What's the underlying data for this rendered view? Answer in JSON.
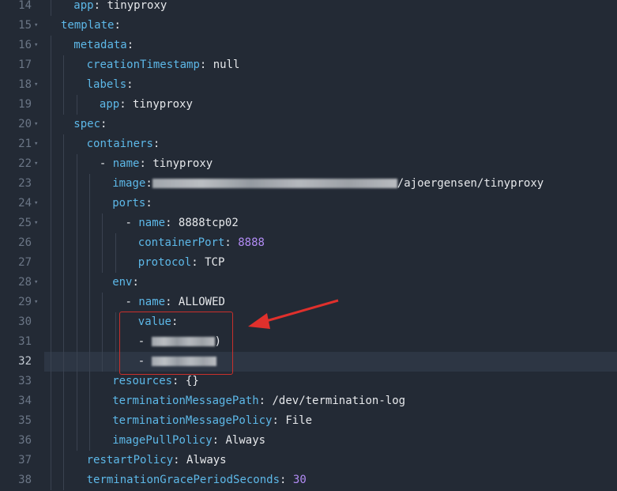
{
  "editor": {
    "lines": [
      {
        "n": "14",
        "fold": false,
        "indent": 2,
        "parts": [
          {
            "t": "app",
            "c": "key"
          },
          {
            "t": ": tinyproxy",
            "c": "txt"
          }
        ]
      },
      {
        "n": "15",
        "fold": true,
        "indent": 1,
        "parts": [
          {
            "t": "template",
            "c": "key"
          },
          {
            "t": ":",
            "c": "txt"
          }
        ]
      },
      {
        "n": "16",
        "fold": true,
        "indent": 2,
        "parts": [
          {
            "t": "metadata",
            "c": "key"
          },
          {
            "t": ":",
            "c": "txt"
          }
        ]
      },
      {
        "n": "17",
        "fold": false,
        "indent": 3,
        "parts": [
          {
            "t": "creationTimestamp",
            "c": "key"
          },
          {
            "t": ": null",
            "c": "txt"
          }
        ]
      },
      {
        "n": "18",
        "fold": true,
        "indent": 3,
        "parts": [
          {
            "t": "labels",
            "c": "key"
          },
          {
            "t": ":",
            "c": "txt"
          }
        ]
      },
      {
        "n": "19",
        "fold": false,
        "indent": 4,
        "parts": [
          {
            "t": "app",
            "c": "key"
          },
          {
            "t": ": tinyproxy",
            "c": "txt"
          }
        ]
      },
      {
        "n": "20",
        "fold": true,
        "indent": 2,
        "parts": [
          {
            "t": "spec",
            "c": "key"
          },
          {
            "t": ":",
            "c": "txt"
          }
        ]
      },
      {
        "n": "21",
        "fold": true,
        "indent": 3,
        "parts": [
          {
            "t": "containers",
            "c": "key"
          },
          {
            "t": ":",
            "c": "txt"
          }
        ]
      },
      {
        "n": "22",
        "fold": true,
        "indent": 4,
        "parts": [
          {
            "t": "- ",
            "c": "txt"
          },
          {
            "t": "name",
            "c": "key"
          },
          {
            "t": ": tinyproxy",
            "c": "txt"
          }
        ]
      },
      {
        "n": "23",
        "fold": false,
        "indent": 5,
        "parts": [
          {
            "t": "image",
            "c": "key"
          },
          {
            "t": ":",
            "c": "txt"
          },
          {
            "t": "",
            "c": "blur",
            "w": 310
          },
          {
            "t": "/ajoergensen/tinyproxy",
            "c": "txt"
          }
        ]
      },
      {
        "n": "24",
        "fold": true,
        "indent": 5,
        "parts": [
          {
            "t": "ports",
            "c": "key"
          },
          {
            "t": ":",
            "c": "txt"
          }
        ]
      },
      {
        "n": "25",
        "fold": true,
        "indent": 6,
        "parts": [
          {
            "t": "- ",
            "c": "txt"
          },
          {
            "t": "name",
            "c": "key"
          },
          {
            "t": ": 8888tcp02",
            "c": "txt"
          }
        ]
      },
      {
        "n": "26",
        "fold": false,
        "indent": 7,
        "parts": [
          {
            "t": "containerPort",
            "c": "key"
          },
          {
            "t": ": ",
            "c": "txt"
          },
          {
            "t": "8888",
            "c": "num-val"
          }
        ]
      },
      {
        "n": "27",
        "fold": false,
        "indent": 7,
        "parts": [
          {
            "t": "protocol",
            "c": "key"
          },
          {
            "t": ": TCP",
            "c": "txt"
          }
        ]
      },
      {
        "n": "28",
        "fold": true,
        "indent": 5,
        "parts": [
          {
            "t": "env",
            "c": "key"
          },
          {
            "t": ":",
            "c": "txt"
          }
        ]
      },
      {
        "n": "29",
        "fold": true,
        "indent": 6,
        "parts": [
          {
            "t": "- ",
            "c": "txt"
          },
          {
            "t": "name",
            "c": "key"
          },
          {
            "t": ": ALLOWED",
            "c": "txt"
          }
        ]
      },
      {
        "n": "30",
        "fold": false,
        "indent": 7,
        "parts": [
          {
            "t": "value",
            "c": "key"
          },
          {
            "t": ":",
            "c": "txt"
          }
        ]
      },
      {
        "n": "31",
        "fold": false,
        "indent": 7,
        "parts": [
          {
            "t": "- ",
            "c": "txt"
          },
          {
            "t": "",
            "c": "blur",
            "w": 80
          },
          {
            "t": ")",
            "c": "txt"
          }
        ]
      },
      {
        "n": "32",
        "fold": false,
        "indent": 7,
        "highlight": true,
        "parts": [
          {
            "t": "- ",
            "c": "txt"
          },
          {
            "t": "",
            "c": "blur",
            "w": 82
          }
        ]
      },
      {
        "n": "33",
        "fold": false,
        "indent": 5,
        "parts": [
          {
            "t": "resources",
            "c": "key"
          },
          {
            "t": ": {}",
            "c": "txt"
          }
        ]
      },
      {
        "n": "34",
        "fold": false,
        "indent": 5,
        "parts": [
          {
            "t": "terminationMessagePath",
            "c": "key"
          },
          {
            "t": ": /dev/termination-log",
            "c": "txt"
          }
        ]
      },
      {
        "n": "35",
        "fold": false,
        "indent": 5,
        "parts": [
          {
            "t": "terminationMessagePolicy",
            "c": "key"
          },
          {
            "t": ": File",
            "c": "txt"
          }
        ]
      },
      {
        "n": "36",
        "fold": false,
        "indent": 5,
        "parts": [
          {
            "t": "imagePullPolicy",
            "c": "key"
          },
          {
            "t": ": Always",
            "c": "txt"
          }
        ]
      },
      {
        "n": "37",
        "fold": false,
        "indent": 3,
        "parts": [
          {
            "t": "restartPolicy",
            "c": "key"
          },
          {
            "t": ": Always",
            "c": "txt"
          }
        ]
      },
      {
        "n": "38",
        "fold": false,
        "indent": 3,
        "parts": [
          {
            "t": "terminationGracePeriodSeconds",
            "c": "key"
          },
          {
            "t": ": ",
            "c": "txt"
          },
          {
            "t": "30",
            "c": "num-val"
          }
        ]
      }
    ]
  },
  "colors": {
    "background": "#232a35",
    "key": "#5db8e8",
    "number": "#b28cf5",
    "text": "#e6e8eb",
    "annotation": "#e0302c"
  },
  "icons": {
    "fold": "chevron-down-icon",
    "annotation": "red-arrow-icon"
  }
}
